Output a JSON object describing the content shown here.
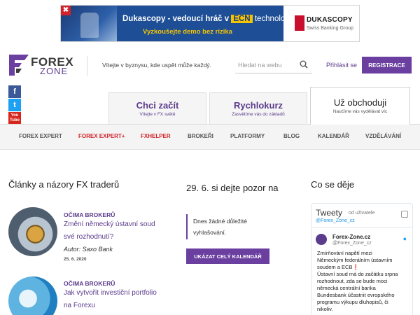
{
  "ad": {
    "brand_line": "Dukascopy - vedoucí hráč v",
    "ecn": "ECN",
    "tech": "technologii",
    "cta": "Vyzkoušejte demo bez rizika",
    "logo_name": "DUKASCOPY",
    "logo_sub": "Swiss Banking Group",
    "close_glyph": "✖"
  },
  "header": {
    "logo_forex": "FOREX",
    "logo_zone": "ZONE",
    "tagline": "Vítejte v byznysu, kde uspět může každý.",
    "search_placeholder": "Hledat na webu",
    "login": "Přihlásit se",
    "register": "REGISTRACE"
  },
  "social": {
    "facebook": "f",
    "twitter": "t",
    "youtube": "You\nTube"
  },
  "tabs": [
    {
      "title": "Chci začít",
      "sub": "Vítejte v FX světě"
    },
    {
      "title": "Rychlokurz",
      "sub": "Zasvětíme vás do základů"
    },
    {
      "title": "Už obchoduji",
      "sub": "Naučíme vás vydělávat víc"
    }
  ],
  "nav": [
    "FOREX EXPERT",
    "FOREX EXPERT+",
    "FXHELPER",
    "BROKEŘI",
    "PLATFORMY",
    "BLOG",
    "KALENDÁŘ",
    "VZDĚLÁVÁNÍ"
  ],
  "articles": {
    "title": "Články a názory FX traderů",
    "items": [
      {
        "category": "OČIMA BROKERŮ",
        "title_l1": "Změní německý ústavní soud",
        "title_l2": "své rozhodnutí?",
        "author": "Autor: Saxo Bank",
        "date": "25. 6. 2020"
      },
      {
        "category": "OČIMA BROKERŮ",
        "title_l1": "Jak vytvořit investiční portfolio",
        "title_l2": "na Forexu"
      }
    ]
  },
  "calendar": {
    "title": "29. 6. si dejte pozor na",
    "no_events_l1": "Dnes žádné důležité",
    "no_events_l2": "vyhlašování.",
    "button": "UKÁZAT CELÝ KALENDÁŘ"
  },
  "news": {
    "title": "Co se děje",
    "widget_title": "Tweety",
    "widget_by": "od uživatele",
    "widget_handle": "@Forex_Zone_cz",
    "tweet_name": "Forex-Zone.cz",
    "tweet_user": "@Forex_Zone_cz",
    "tweet_text_l1": "Zmírňování napětí mezi",
    "tweet_text_l2": "Německým federálním ústavním",
    "tweet_text_l3": "soudem a ECB",
    "tweet_text_l3_mark": "❗",
    "tweet_text_l4": "Ústavní soud má do začátku srpna",
    "tweet_text_l5": "rozhodnout, zda se bude moci",
    "tweet_text_l6": "německá centrální banka",
    "tweet_text_l7": "Bundesbank účastnit evropského",
    "tweet_text_l8": "programu výkupu dluhopisů, či",
    "tweet_text_l9": "nikoliv."
  },
  "colors": {
    "brand": "#6a3fa0",
    "accent_red": "#d2232a",
    "link": "#5b3b8c"
  }
}
